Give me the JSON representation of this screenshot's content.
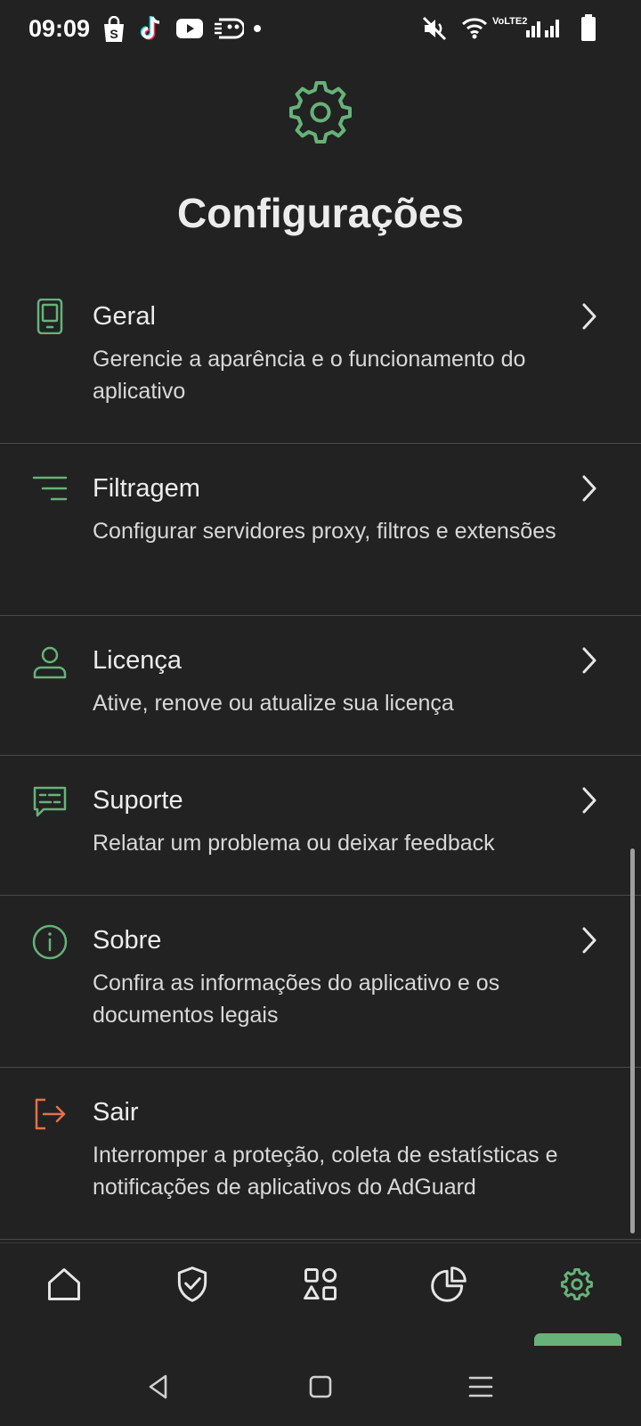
{
  "status_bar": {
    "time": "09:09",
    "network_label": "VoLTE2",
    "left_icons": [
      "shopping-bag-icon",
      "tiktok-icon",
      "youtube-icon",
      "mask-icon"
    ],
    "right_icons": [
      "mute-icon",
      "wifi-icon",
      "signal-icon",
      "battery-icon"
    ]
  },
  "header": {
    "icon": "gear-icon",
    "title": "Configurações"
  },
  "settings": [
    {
      "icon": "phone-icon",
      "title": "Geral",
      "description": "Gerencie a aparência e o funcionamento do aplicativo",
      "has_chevron": true
    },
    {
      "icon": "filter-icon",
      "title": "Filtragem",
      "description": "Configurar servidores proxy, filtros e extensões",
      "has_chevron": true
    },
    {
      "icon": "user-icon",
      "title": "Licença",
      "description": "Ative, renove ou atualize sua licença",
      "has_chevron": true
    },
    {
      "icon": "chat-icon",
      "title": "Suporte",
      "description": "Relatar um problema ou deixar feedback",
      "has_chevron": true
    },
    {
      "icon": "info-icon",
      "title": "Sobre",
      "description": "Confira as informações do aplicativo e os documentos legais",
      "has_chevron": true
    },
    {
      "icon": "exit-icon",
      "title": "Sair",
      "description": "Interromper a proteção, coleta de estatísticas e notificações de aplicativos do AdGuard",
      "has_chevron": false
    }
  ],
  "bottom_nav": {
    "items": [
      "home-icon",
      "shield-check-icon",
      "apps-icon",
      "pie-chart-icon",
      "gear-icon"
    ],
    "active_index": 4
  },
  "colors": {
    "background": "#222222",
    "accent": "#67b279",
    "exit": "#e5704a",
    "text": "#ececec",
    "divider": "#4a4a4a"
  }
}
